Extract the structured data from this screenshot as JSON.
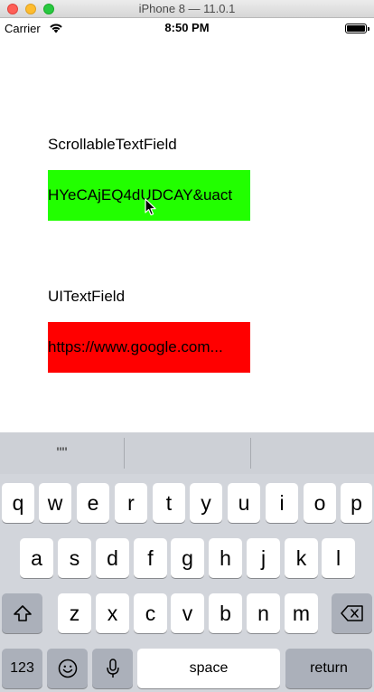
{
  "window": {
    "title": "iPhone 8 — 11.0.1"
  },
  "status_bar": {
    "carrier": "Carrier",
    "time": "8:50 PM",
    "wifi_icon": "wifi-icon",
    "battery_icon": "battery-icon"
  },
  "fields": {
    "scrollable_label": "ScrollableTextField",
    "scrollable_value": "HYeCAjEQ4dUDCAY&uact",
    "scrollable_color": "#22ff00",
    "uitextfield_label": "UITextField",
    "uitextfield_value": "https://www.google.com...",
    "uitextfield_color": "#ff0000"
  },
  "keyboard": {
    "predictive": [
      "\"\"",
      "",
      ""
    ],
    "row1": [
      "q",
      "w",
      "e",
      "r",
      "t",
      "y",
      "u",
      "i",
      "o",
      "p"
    ],
    "row2": [
      "a",
      "s",
      "d",
      "f",
      "g",
      "h",
      "j",
      "k",
      "l"
    ],
    "row3": [
      "z",
      "x",
      "c",
      "v",
      "b",
      "n",
      "m"
    ],
    "shift_icon": "shift-icon",
    "delete_icon": "delete-icon",
    "numbers_label": "123",
    "emoji_icon": "emoji-icon",
    "mic_icon": "microphone-icon",
    "space_label": "space",
    "return_label": "return"
  }
}
